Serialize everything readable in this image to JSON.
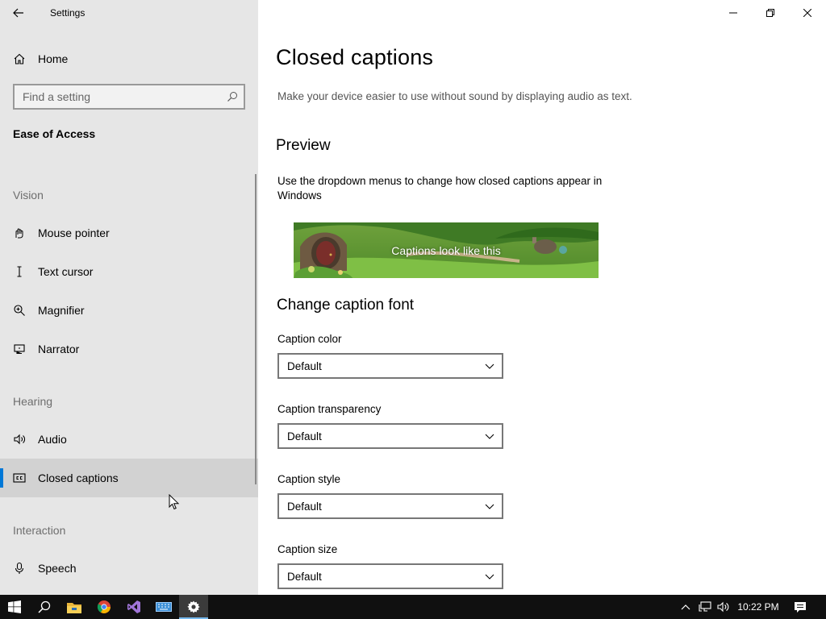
{
  "window": {
    "app_title": "Settings",
    "controls": {
      "minimize_icon": "minimize-icon",
      "maximize_icon": "restore-icon",
      "close_icon": "close-icon"
    }
  },
  "sidebar": {
    "home": "Home",
    "search": {
      "placeholder": "Find a setting",
      "icon": "search-icon"
    },
    "category": "Ease of Access",
    "groups": {
      "vision": "Vision",
      "hearing": "Hearing",
      "interaction": "Interaction"
    },
    "items": {
      "mouse_pointer": "Mouse pointer",
      "text_cursor": "Text cursor",
      "magnifier": "Magnifier",
      "narrator": "Narrator",
      "audio": "Audio",
      "closed_captions": "Closed captions",
      "speech": "Speech"
    },
    "selected": "Closed captions",
    "accent_color": "#0078d7"
  },
  "main": {
    "title": "Closed captions",
    "description": "Make your device easier to use without sound by displaying audio as text.",
    "preview": {
      "heading": "Preview",
      "description": "Use the dropdown menus to change how closed captions appear in Windows",
      "caption_text": "Captions look like this"
    },
    "font_section": {
      "heading": "Change caption font",
      "fields": {
        "color": {
          "label": "Caption color",
          "value": "Default"
        },
        "transparency": {
          "label": "Caption transparency",
          "value": "Default"
        },
        "style": {
          "label": "Caption style",
          "value": "Default"
        },
        "size": {
          "label": "Caption size",
          "value": "Default"
        }
      }
    }
  },
  "taskbar": {
    "apps": [
      "start-icon",
      "search-icon",
      "file-explorer-icon",
      "chrome-icon",
      "visual-studio-icon",
      "keyboard-icon",
      "settings-icon"
    ],
    "clock": "10:22 PM",
    "tray": [
      "chevron-up-icon",
      "network-icon",
      "volume-icon",
      "notification-icon"
    ]
  }
}
